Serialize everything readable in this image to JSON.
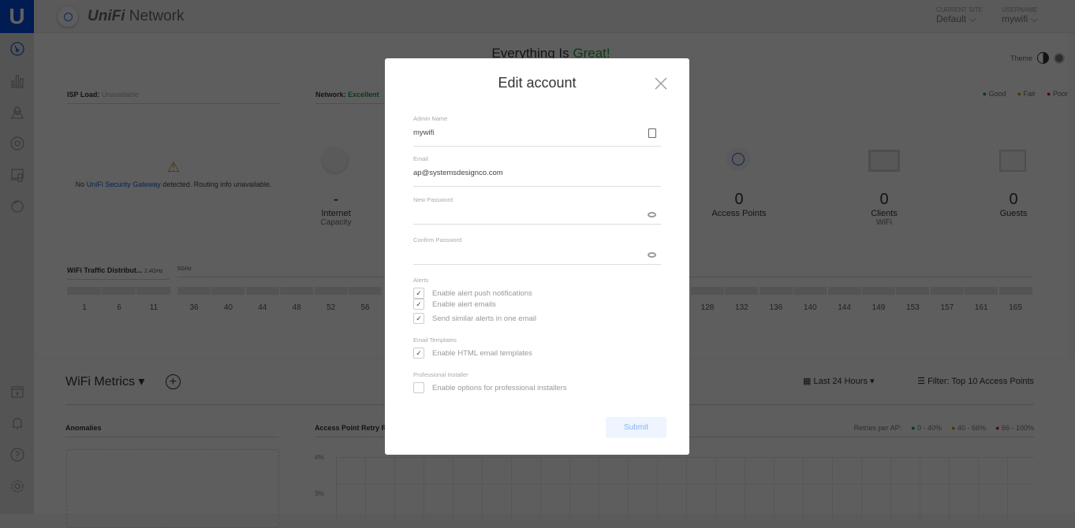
{
  "header": {
    "app_name_brand": "UniFi",
    "app_name": "Network",
    "current_site_label": "CURRENT SITE",
    "current_site": "Default",
    "username_label": "USERNAME",
    "username": "mywifi"
  },
  "dashboard": {
    "headline_prefix": "Everything Is",
    "headline_status": "Great!",
    "theme_label": "Theme",
    "isp_load_label": "ISP Load:",
    "isp_load_value": "Unavailable",
    "network_label": "Network:",
    "network_value": "Excellent",
    "legend": [
      {
        "label": "Good",
        "color": "#1a9a3a"
      },
      {
        "label": "Fair",
        "color": "#d08a10"
      },
      {
        "label": "Poor",
        "color": "#c02020"
      }
    ],
    "gateway_msg_prefix": "No",
    "gateway_link": "UniFi Security Gateway",
    "gateway_msg_suffix": "detected. Routing info unavailable.",
    "stats": [
      {
        "value": "-",
        "label": "Internet",
        "sub": "Capacity"
      },
      {
        "value": "0",
        "label": "Access Points",
        "sub": ""
      },
      {
        "value": "0",
        "label": "Clients",
        "sub": "WiFi"
      },
      {
        "value": "0",
        "label": "Guests",
        "sub": ""
      }
    ],
    "traffic_title": "WiFi Traffic Distribut...",
    "band_24": "2.4GHz",
    "band_5": "5GHz",
    "channels_24": [
      "1",
      "6",
      "11"
    ],
    "channels_5": [
      "36",
      "40",
      "44",
      "48",
      "52",
      "56",
      "128",
      "132",
      "136",
      "140",
      "144",
      "149",
      "153",
      "157",
      "161",
      "165"
    ]
  },
  "metrics": {
    "title": "WiFi Metrics",
    "time_range": "Last 24 Hours",
    "filter": "Filter: Top 10 Access Points",
    "anomalies": "Anomalies",
    "retry_title": "Access Point Retry R",
    "retries_label": "Retries per AP:",
    "retry_legend": [
      {
        "label": "0 - 40%",
        "color": "#1a9a3a"
      },
      {
        "label": "40 - 66%",
        "color": "#d08a10"
      },
      {
        "label": "66 - 100%",
        "color": "#c02020"
      }
    ],
    "y_ticks": [
      "4%",
      "3%"
    ]
  },
  "modal": {
    "title": "Edit account",
    "admin_name_label": "Admin Name",
    "admin_name": "mywifi",
    "email_label": "Email",
    "email": "ap@systemsdesignco.com",
    "new_password_label": "New Password",
    "confirm_password_label": "Confirm Password",
    "alerts_label": "Alerts",
    "alerts": [
      {
        "label": "Enable alert push notifications",
        "checked": true
      },
      {
        "label": "Enable alert emails",
        "checked": true
      },
      {
        "label": "Send similar alerts in one email",
        "checked": true
      }
    ],
    "templates_label": "Email Templates",
    "templates": [
      {
        "label": "Enable HTML email templates",
        "checked": true
      }
    ],
    "installer_label": "Professional Installer",
    "installer": [
      {
        "label": "Enable options for professional installers",
        "checked": false
      }
    ],
    "submit": "Submit"
  }
}
